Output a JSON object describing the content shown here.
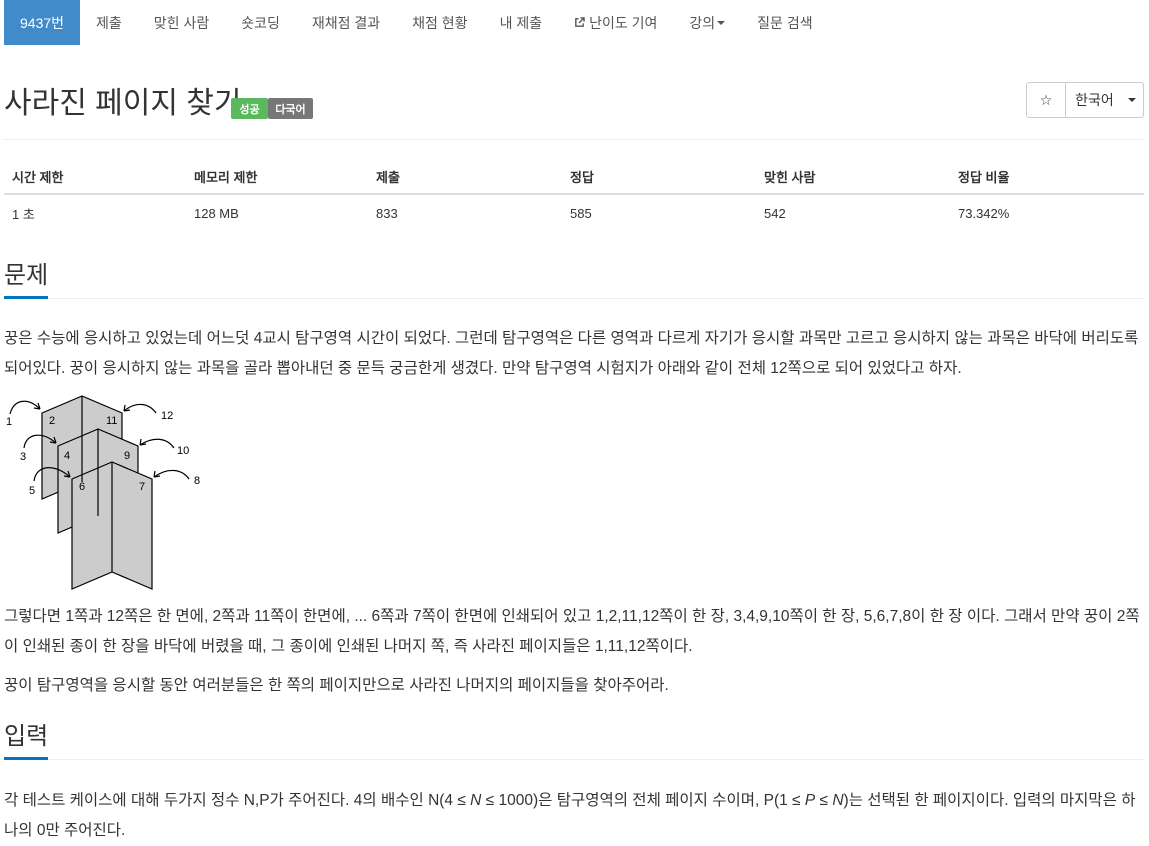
{
  "nav": {
    "items": [
      {
        "label": "9437번",
        "active": true
      },
      {
        "label": "제출"
      },
      {
        "label": "맞힌 사람"
      },
      {
        "label": "숏코딩"
      },
      {
        "label": "재채점 결과"
      },
      {
        "label": "채점 현황"
      },
      {
        "label": "내 제출"
      },
      {
        "label": "난이도 기여",
        "icon": "external-link-icon"
      },
      {
        "label": "강의",
        "dropdown": true
      },
      {
        "label": "질문 검색"
      }
    ]
  },
  "problem": {
    "title": "사라진 페이지 찾기",
    "labels": {
      "status": "성공",
      "language": "다국어"
    },
    "star": "☆",
    "language_select": "한국어"
  },
  "info": {
    "headers": [
      "시간 제한",
      "메모리 제한",
      "제출",
      "정답",
      "맞힌 사람",
      "정답 비율"
    ],
    "values": [
      "1 초",
      "128 MB",
      "833",
      "585",
      "542",
      "73.342%"
    ]
  },
  "sections": {
    "problem_heading": "문제",
    "input_heading": "입력",
    "problem_p1": "꿍은 수능에 응시하고 있었는데 어느덧 4교시 탐구영역 시간이 되었다. 그런데 탐구영역은 다른 영역과 다르게 자기가 응시할 과목만 고르고 응시하지 않는 과목은 바닥에 버리도록 되어있다. 꿍이 응시하지 않는 과목을 골라 뽑아내던 중 문득 궁금한게 생겼다. 만약 탐구영역 시험지가 아래와 같이 전체 12쪽으로 되어 있었다고 하자.",
    "problem_p2": "그렇다면 1쪽과 12쪽은 한 면에, 2쪽과 11쪽이 한면에, ... 6쪽과 7쪽이 한면에 인쇄되어 있고 1,2,11,12쪽이 한 장, 3,4,9,10쪽이 한 장, 5,6,7,8이 한 장 이다. 그래서 만약 꿍이 2쪽이 인쇄된 종이 한 장을 바닥에 버렸을 때, 그 종이에 인쇄된 나머지 쪽, 즉 사라진 페이지들은 1,11,12쪽이다.",
    "problem_p3": "꿍이 탐구영역을 응시할 동안 여러분들은 한 쪽의 페이지만으로 사라진 나머지의 페이지들을 찾아주어라.",
    "input_p1_a": "각 테스트 케이스에 대해 두가지 정수 N,P가 주어진다. 4의 배수인 N(4 ≤ ",
    "input_var_n": "N",
    "input_p1_b": " ≤ 1000)은 탐구영역의 전체 페이지 수이며, P(1 ≤ ",
    "input_var_p": "P",
    "input_p1_c": " ≤ ",
    "input_var_n2": "N",
    "input_p1_d": ")는 선택된 한 페이지이다. 입력의 마지막은 하나의 0만 주어진다."
  },
  "figure": {
    "page_numbers": [
      "1",
      "2",
      "11",
      "12",
      "3",
      "4",
      "9",
      "10",
      "5",
      "6",
      "7",
      "8"
    ]
  }
}
